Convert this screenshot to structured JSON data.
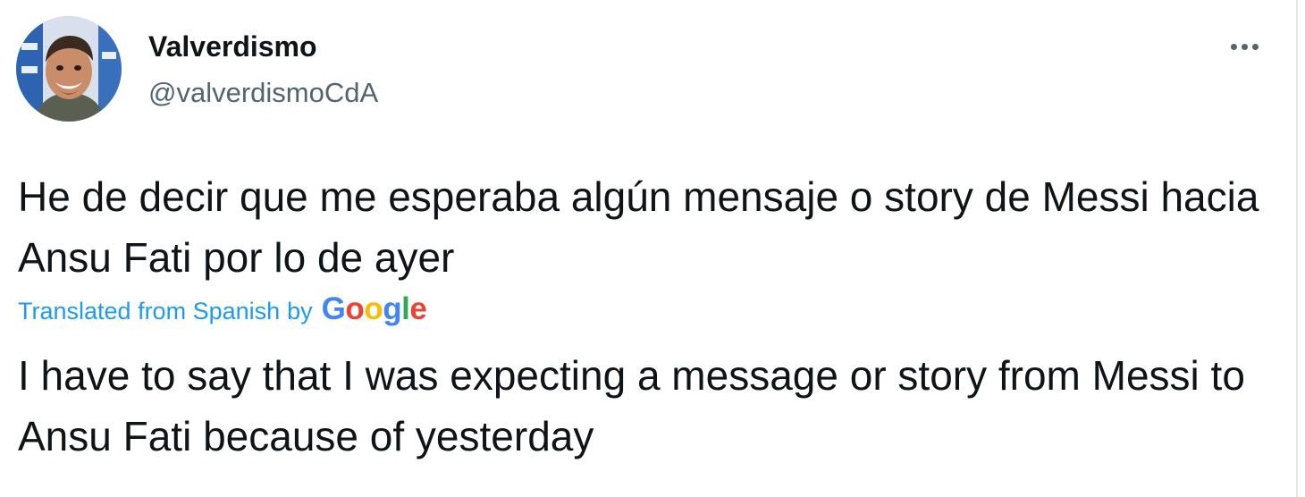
{
  "tweet": {
    "display_name": "Valverdismo",
    "handle": "@valverdismoCdA",
    "more_icon": "more-horizontal-icon",
    "original_text": "He de decir que me esperaba algún mensaje o story de Messi hacia Ansu Fati por lo de ayer",
    "translation_label": "Translated from Spanish",
    "translation_by": "by",
    "translation_provider": [
      "G",
      "o",
      "o",
      "g",
      "l",
      "e"
    ],
    "translated_text": "I have to say that I was expecting a message or story from Messi to Ansu Fati because of yesterday"
  },
  "colors": {
    "text": "#0f1419",
    "secondary": "#536471",
    "link": "#1d9bf0"
  }
}
